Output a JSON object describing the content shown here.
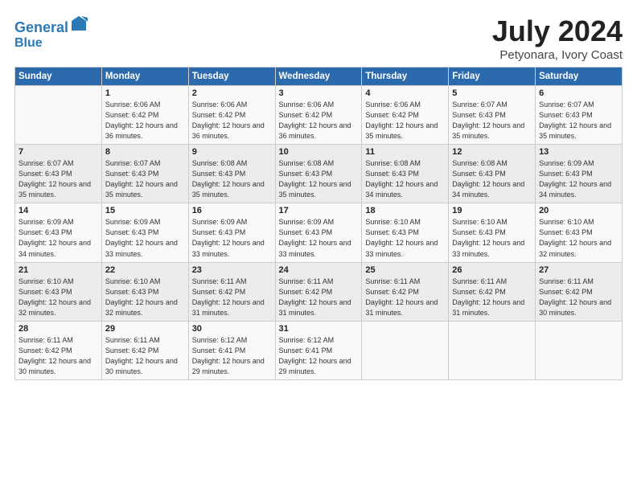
{
  "header": {
    "logo_line1": "General",
    "logo_line2": "Blue",
    "month": "July 2024",
    "location": "Petyonara, Ivory Coast"
  },
  "weekdays": [
    "Sunday",
    "Monday",
    "Tuesday",
    "Wednesday",
    "Thursday",
    "Friday",
    "Saturday"
  ],
  "weeks": [
    [
      {
        "day": "",
        "info": ""
      },
      {
        "day": "1",
        "info": "Sunrise: 6:06 AM\nSunset: 6:42 PM\nDaylight: 12 hours\nand 36 minutes."
      },
      {
        "day": "2",
        "info": "Sunrise: 6:06 AM\nSunset: 6:42 PM\nDaylight: 12 hours\nand 36 minutes."
      },
      {
        "day": "3",
        "info": "Sunrise: 6:06 AM\nSunset: 6:42 PM\nDaylight: 12 hours\nand 36 minutes."
      },
      {
        "day": "4",
        "info": "Sunrise: 6:06 AM\nSunset: 6:42 PM\nDaylight: 12 hours\nand 35 minutes."
      },
      {
        "day": "5",
        "info": "Sunrise: 6:07 AM\nSunset: 6:43 PM\nDaylight: 12 hours\nand 35 minutes."
      },
      {
        "day": "6",
        "info": "Sunrise: 6:07 AM\nSunset: 6:43 PM\nDaylight: 12 hours\nand 35 minutes."
      }
    ],
    [
      {
        "day": "7",
        "info": "Sunrise: 6:07 AM\nSunset: 6:43 PM\nDaylight: 12 hours\nand 35 minutes."
      },
      {
        "day": "8",
        "info": "Sunrise: 6:07 AM\nSunset: 6:43 PM\nDaylight: 12 hours\nand 35 minutes."
      },
      {
        "day": "9",
        "info": "Sunrise: 6:08 AM\nSunset: 6:43 PM\nDaylight: 12 hours\nand 35 minutes."
      },
      {
        "day": "10",
        "info": "Sunrise: 6:08 AM\nSunset: 6:43 PM\nDaylight: 12 hours\nand 35 minutes."
      },
      {
        "day": "11",
        "info": "Sunrise: 6:08 AM\nSunset: 6:43 PM\nDaylight: 12 hours\nand 34 minutes."
      },
      {
        "day": "12",
        "info": "Sunrise: 6:08 AM\nSunset: 6:43 PM\nDaylight: 12 hours\nand 34 minutes."
      },
      {
        "day": "13",
        "info": "Sunrise: 6:09 AM\nSunset: 6:43 PM\nDaylight: 12 hours\nand 34 minutes."
      }
    ],
    [
      {
        "day": "14",
        "info": "Sunrise: 6:09 AM\nSunset: 6:43 PM\nDaylight: 12 hours\nand 34 minutes."
      },
      {
        "day": "15",
        "info": "Sunrise: 6:09 AM\nSunset: 6:43 PM\nDaylight: 12 hours\nand 33 minutes."
      },
      {
        "day": "16",
        "info": "Sunrise: 6:09 AM\nSunset: 6:43 PM\nDaylight: 12 hours\nand 33 minutes."
      },
      {
        "day": "17",
        "info": "Sunrise: 6:09 AM\nSunset: 6:43 PM\nDaylight: 12 hours\nand 33 minutes."
      },
      {
        "day": "18",
        "info": "Sunrise: 6:10 AM\nSunset: 6:43 PM\nDaylight: 12 hours\nand 33 minutes."
      },
      {
        "day": "19",
        "info": "Sunrise: 6:10 AM\nSunset: 6:43 PM\nDaylight: 12 hours\nand 33 minutes."
      },
      {
        "day": "20",
        "info": "Sunrise: 6:10 AM\nSunset: 6:43 PM\nDaylight: 12 hours\nand 32 minutes."
      }
    ],
    [
      {
        "day": "21",
        "info": "Sunrise: 6:10 AM\nSunset: 6:43 PM\nDaylight: 12 hours\nand 32 minutes."
      },
      {
        "day": "22",
        "info": "Sunrise: 6:10 AM\nSunset: 6:43 PM\nDaylight: 12 hours\nand 32 minutes."
      },
      {
        "day": "23",
        "info": "Sunrise: 6:11 AM\nSunset: 6:42 PM\nDaylight: 12 hours\nand 31 minutes."
      },
      {
        "day": "24",
        "info": "Sunrise: 6:11 AM\nSunset: 6:42 PM\nDaylight: 12 hours\nand 31 minutes."
      },
      {
        "day": "25",
        "info": "Sunrise: 6:11 AM\nSunset: 6:42 PM\nDaylight: 12 hours\nand 31 minutes."
      },
      {
        "day": "26",
        "info": "Sunrise: 6:11 AM\nSunset: 6:42 PM\nDaylight: 12 hours\nand 31 minutes."
      },
      {
        "day": "27",
        "info": "Sunrise: 6:11 AM\nSunset: 6:42 PM\nDaylight: 12 hours\nand 30 minutes."
      }
    ],
    [
      {
        "day": "28",
        "info": "Sunrise: 6:11 AM\nSunset: 6:42 PM\nDaylight: 12 hours\nand 30 minutes."
      },
      {
        "day": "29",
        "info": "Sunrise: 6:11 AM\nSunset: 6:42 PM\nDaylight: 12 hours\nand 30 minutes."
      },
      {
        "day": "30",
        "info": "Sunrise: 6:12 AM\nSunset: 6:41 PM\nDaylight: 12 hours\nand 29 minutes."
      },
      {
        "day": "31",
        "info": "Sunrise: 6:12 AM\nSunset: 6:41 PM\nDaylight: 12 hours\nand 29 minutes."
      },
      {
        "day": "",
        "info": ""
      },
      {
        "day": "",
        "info": ""
      },
      {
        "day": "",
        "info": ""
      }
    ]
  ]
}
